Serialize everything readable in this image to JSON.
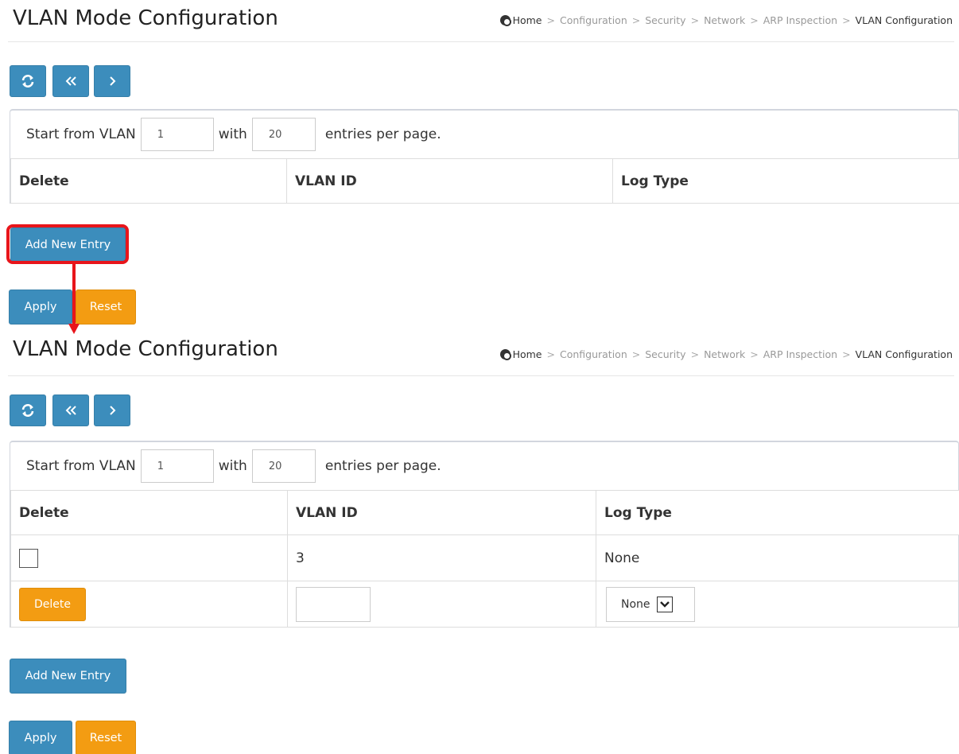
{
  "colors": {
    "primary": "#3c8dbc",
    "warning": "#f39c12",
    "highlight": "#e8151b"
  },
  "icons": {
    "refresh": "refresh-icon",
    "first_page": "double-chevron-left-icon",
    "next_page": "chevron-right-icon",
    "home": "home-icon",
    "dropdown": "chevron-down-icon"
  },
  "breadcrumb": {
    "items": [
      "Home",
      "Configuration",
      "Security",
      "Network",
      "ARP Inspection",
      "VLAN Configuration"
    ],
    "separator": ">"
  },
  "panels": [
    {
      "title": "VLAN Mode Configuration",
      "paging": {
        "label_start": "Start from VLAN",
        "start_value": "1",
        "label_with": "with",
        "per_page_value": "20",
        "label_suffix": "entries per page."
      },
      "table": {
        "headers": [
          "Delete",
          "VLAN ID",
          "Log Type"
        ]
      },
      "buttons": {
        "add_new": "Add New Entry",
        "apply": "Apply",
        "reset": "Reset"
      }
    },
    {
      "title": "VLAN Mode Configuration",
      "paging": {
        "label_start": "Start from VLAN",
        "start_value": "1",
        "label_with": "with",
        "per_page_value": "20",
        "label_suffix": "entries per page."
      },
      "table": {
        "headers": [
          "Delete",
          "VLAN ID",
          "Log Type"
        ],
        "rows": [
          {
            "vlan_id": "3",
            "log_type": "None"
          }
        ],
        "new_row": {
          "delete_label": "Delete",
          "vlan_id_value": "",
          "log_type_selected": "None"
        }
      },
      "buttons": {
        "add_new": "Add New Entry",
        "apply": "Apply",
        "reset": "Reset"
      }
    }
  ]
}
